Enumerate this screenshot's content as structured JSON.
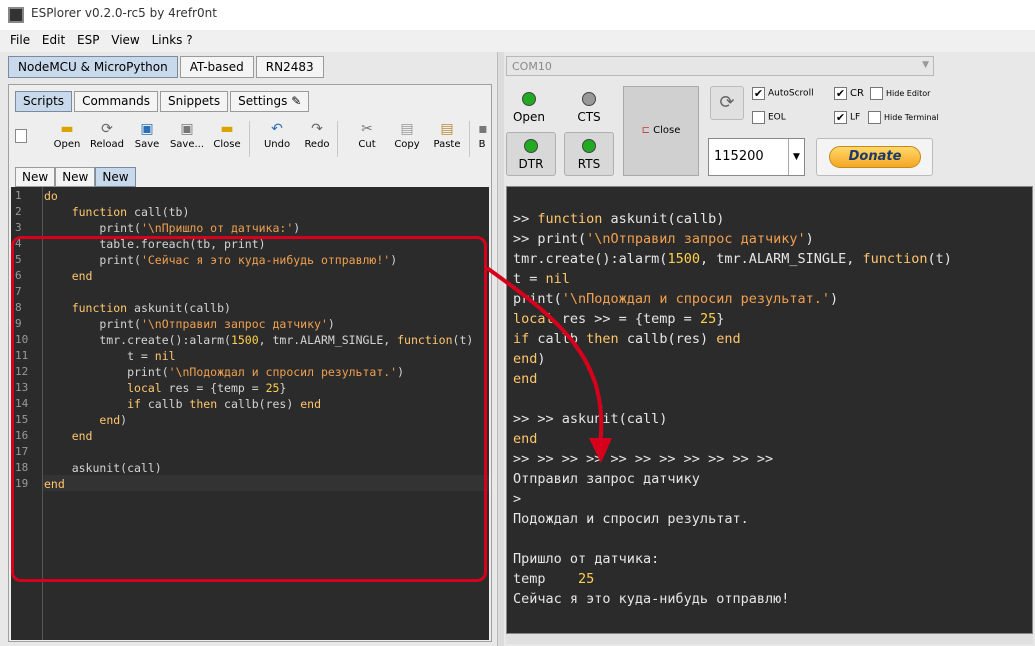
{
  "window": {
    "title": "ESPlorer v0.2.0-rc5 by 4refr0nt"
  },
  "menu": [
    "File",
    "Edit",
    "ESP",
    "View",
    "Links ?"
  ],
  "left": {
    "top_tabs": [
      "NodeMCU & MicroPython",
      "AT-based",
      "RN2483"
    ],
    "sub_tabs": [
      "Scripts",
      "Commands",
      "Snippets",
      "Settings"
    ],
    "toolbar": [
      "Open",
      "Reload",
      "Save",
      "Save...",
      "Close",
      "Undo",
      "Redo",
      "Cut",
      "Copy",
      "Paste",
      "B"
    ],
    "file_tabs": [
      "New",
      "New",
      "New"
    ],
    "line_numbers": [
      "1",
      "2",
      "3",
      "4",
      "5",
      "6",
      "7",
      "8",
      "9",
      "10",
      "11",
      "12",
      "13",
      "14",
      "15",
      "16",
      "17",
      "18",
      "19"
    ]
  },
  "right": {
    "port": "COM10",
    "open_label": "Open",
    "cts_label": "CTS",
    "dtr_label": "DTR",
    "rts_label": "RTS",
    "close_label": "Close",
    "autoscroll_label": "AutoScroll",
    "cr_label": "CR",
    "hide_editor_label": "Hide Editor",
    "eol_label": "EOL",
    "lf_label": "LF",
    "hide_terminal_label": "Hide Terminal",
    "baud": "115200",
    "donate_label": "Donate",
    "checks": {
      "autoscroll": true,
      "cr": true,
      "hide_editor": false,
      "eol": false,
      "lf": true,
      "hide_terminal": false
    },
    "status_colors": {
      "open": "#22aa22",
      "cts": "#999999",
      "dtr": "#22aa22",
      "rts": "#22aa22"
    }
  },
  "colors": {
    "editor_bg": "#2b2b2b",
    "keyword": "#ffc66d",
    "string": "#f0a050",
    "highlight": "#d6001c"
  }
}
